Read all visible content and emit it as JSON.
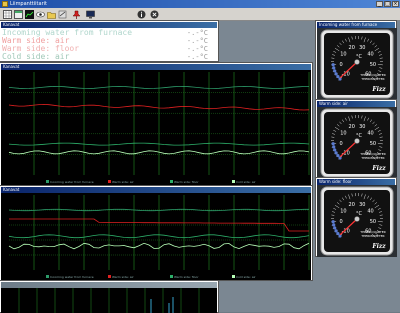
{
  "app": {
    "title": "Liimpanttiitarit",
    "window_buttons": [
      "_",
      "□",
      "×"
    ]
  },
  "toolbar": {
    "icons": [
      "grid-icon",
      "table-icon",
      "chart-icon",
      "eye-icon",
      "folder-icon",
      "export-icon",
      "pin-icon",
      "monitor-icon",
      "info-icon",
      "close-circle-icon"
    ]
  },
  "legend": {
    "title": "Kanavat",
    "rows": [
      {
        "label": "Incoming water from furnace",
        "value": "-.-°C",
        "color": "#b0d6cc"
      },
      {
        "label": "Warm side: air",
        "value": "-.-°C",
        "color": "#f0a0a0"
      },
      {
        "label": "Warm side: floor",
        "value": "-.-°C",
        "color": "#f0b0b0"
      },
      {
        "label": "Cold side: air",
        "value": "-.-°C",
        "color": "#a0c8b8"
      }
    ]
  },
  "chart1": {
    "title": "Kanavat",
    "legend": [
      "Incoming water from furnace",
      "Warm side: air",
      "Warm side: floor",
      "Cold side: air"
    ]
  },
  "chart2": {
    "title": "Kanavat",
    "legend": [
      "Incoming water from furnace",
      "Warm side: air",
      "Warm side: floor",
      "Cold side: air"
    ]
  },
  "gauges": [
    {
      "title": "Incoming water from furnace",
      "unit": "°C",
      "brand1": "THREE-QUARTER",
      "brand2": "THERMOMETER",
      "logo": "Fizz",
      "ticks": [
        "-10",
        "0",
        "10",
        "20",
        "30",
        "40",
        "50",
        "60"
      ]
    },
    {
      "title": "Warm side: air",
      "unit": "°C",
      "brand1": "THREE-QUARTER",
      "brand2": "THERMOMETER",
      "logo": "Fizz",
      "ticks": [
        "-10",
        "0",
        "10",
        "20",
        "30",
        "40",
        "50",
        "60"
      ]
    },
    {
      "title": "Warm side: floor",
      "unit": "°C",
      "brand1": "THREE-QUARTER",
      "brand2": "THERMOMETER",
      "logo": "Fizz",
      "ticks": [
        "-10",
        "0",
        "10",
        "20",
        "30",
        "40",
        "50",
        "60"
      ]
    }
  ],
  "colors": {
    "plot_bg": "#000000",
    "grid": "#1f7a1f",
    "series_water": "#2d9c6a",
    "series_warm_air": "#e02020",
    "series_warm_floor": "#2db06a",
    "series_cold_air": "#b8ffb8"
  }
}
